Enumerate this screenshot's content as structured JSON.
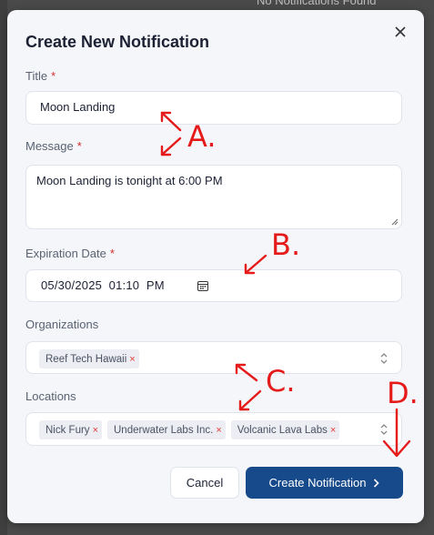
{
  "background": {
    "notice": "No Notifications Found"
  },
  "modal": {
    "title": "Create New Notification",
    "close_icon": "close-icon",
    "required_marker": "*",
    "title_field": {
      "label": "Title",
      "value": "Moon Landing"
    },
    "message_field": {
      "label": "Message",
      "value": "Moon Landing is tonight at 6:00 PM"
    },
    "expiration_field": {
      "label": "Expiration Date",
      "value": "05/30/2025  01:10  PM",
      "icon": "calendar-icon"
    },
    "organizations_field": {
      "label": "Organizations",
      "chips": [
        "Reef Tech Hawaii"
      ]
    },
    "locations_field": {
      "label": "Locations",
      "chips": [
        "Nick Fury",
        "Underwater Labs Inc.",
        "Volcanic Lava Labs"
      ]
    },
    "chip_remove": "×",
    "cancel_label": "Cancel",
    "create_label": "Create Notification",
    "create_icon": "chevron-right-icon"
  },
  "annotations": {
    "a": "A.",
    "b": "B.",
    "c": "C.",
    "d": "D."
  },
  "colors": {
    "primary": "#174a8b",
    "required": "#d32f2f",
    "annotation": "#e51b1b",
    "background": "#f4f6fa"
  }
}
